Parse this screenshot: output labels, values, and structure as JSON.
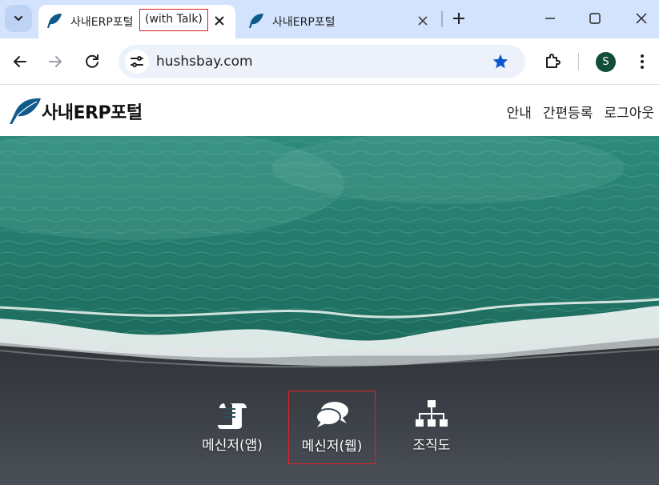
{
  "browser": {
    "tabs": [
      {
        "title": "사내ERP포털",
        "title_extra": "(with Talk)",
        "active": true
      },
      {
        "title": "사내ERP포털",
        "active": false
      }
    ],
    "url": "hushsbay.com",
    "profile_initial": "S",
    "accent_color": "#0b57d0"
  },
  "site": {
    "logo_text": "사내ERP포털",
    "nav": [
      "안내",
      "간편등록",
      "로그아웃"
    ]
  },
  "features": [
    {
      "label": "메신저(앱)",
      "icon": "scroll-icon"
    },
    {
      "label": "메신저(웹)",
      "icon": "chat-bubbles-icon"
    },
    {
      "label": "조직도",
      "icon": "org-chart-icon"
    }
  ]
}
